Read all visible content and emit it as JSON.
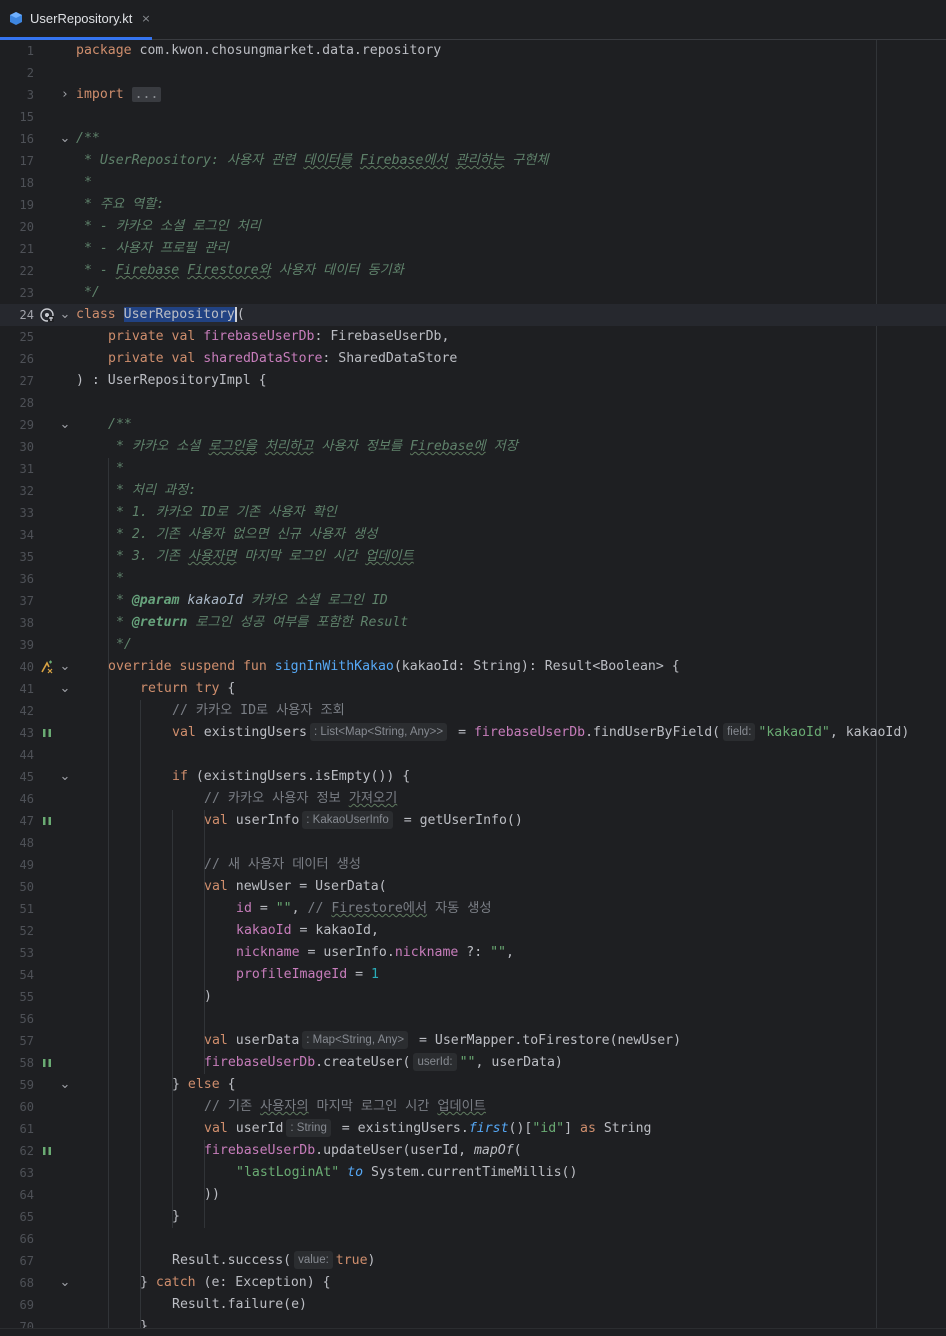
{
  "tab": {
    "title": "UserRepository.kt",
    "close": "×"
  },
  "placeholder": "...",
  "hints": {
    "existingUsers": ": List<Map<String, Any>>",
    "field": "field:",
    "userInfo": ": KakaoUserInfo",
    "userData": ": Map<String, Any>",
    "userIdArg": "userId:",
    "userIdType": ": String",
    "value": "value:"
  },
  "line_numbers": [
    "1",
    "2",
    "3",
    "15",
    "16",
    "17",
    "18",
    "19",
    "20",
    "21",
    "22",
    "23",
    "24",
    "25",
    "26",
    "27",
    "28",
    "29",
    "30",
    "31",
    "32",
    "33",
    "34",
    "35",
    "36",
    "37",
    "38",
    "39",
    "40",
    "41",
    "42",
    "43",
    "44",
    "45",
    "46",
    "47",
    "48",
    "49",
    "50",
    "51",
    "52",
    "53",
    "54",
    "55",
    "56",
    "57",
    "58",
    "59",
    "60",
    "61",
    "62",
    "63",
    "64",
    "65",
    "66",
    "67",
    "68",
    "69",
    "70"
  ],
  "code": {
    "l1": [
      "package",
      " com.kwon.chosungmarket.data.repository"
    ],
    "l3": [
      "import",
      " "
    ],
    "l16": [
      "/**"
    ],
    "l17": [
      " * UserRepository: 사용자 관련 ",
      "데이터를",
      " ",
      "Firebase에서",
      " ",
      "관리하는",
      " 구현체"
    ],
    "l18": [
      " *"
    ],
    "l19": [
      " * 주요 역할:"
    ],
    "l20": [
      " * - 카카오 소셜 로그인 처리"
    ],
    "l21": [
      " * - 사용자 프로필 관리"
    ],
    "l22": [
      " * - ",
      "Firebase",
      " ",
      "Firestore와",
      " 사용자 데이터 동기화"
    ],
    "l23": [
      " */"
    ],
    "l24": [
      "class",
      " ",
      "UserRepository",
      "("
    ],
    "l25": [
      "private val",
      " ",
      "firebaseUserDb",
      ": FirebaseUserDb,"
    ],
    "l26": [
      "private val",
      " ",
      "sharedDataStore",
      ": SharedDataStore"
    ],
    "l27": [
      ") : UserRepositoryImpl {"
    ],
    "l29": [
      "/**"
    ],
    "l30": [
      " * 카카오 소셜 ",
      "로그인을",
      " ",
      "처리하고",
      " 사용자 정보를 ",
      "Firebase에",
      " 저장"
    ],
    "l31": [
      " *"
    ],
    "l32": [
      " * 처리 과정:"
    ],
    "l33": [
      " * 1. 카카오 ID로 기존 사용자 확인"
    ],
    "l34": [
      " * 2. 기존 사용자 없으면 신규 사용자 생성"
    ],
    "l35": [
      " * 3. 기존 ",
      "사용자면",
      " 마지막 로그인 시간 ",
      "업데이트"
    ],
    "l36": [
      " *"
    ],
    "l37": [
      " * ",
      "@param",
      " ",
      "kakaoId",
      " 카카오 소셜 로그인 ID"
    ],
    "l38": [
      " * ",
      "@return",
      " 로그인 성공 여부를 포함한 Result"
    ],
    "l39": [
      " */"
    ],
    "l40": [
      "override suspend fun",
      " ",
      "signInWithKakao",
      "(kakaoId: String): Result<Boolean> {"
    ],
    "l41": [
      "return try",
      " {"
    ],
    "l42": [
      "// 카카오 ID로 사용자 조회"
    ],
    "l43a": [
      "val",
      " existingUsers"
    ],
    "l43b": [
      " = ",
      "firebaseUserDb",
      ".findUserByField(",
      "\"kakaoId\"",
      ", kakaoId)"
    ],
    "l45": [
      "if",
      " (existingUsers.isEmpty()) {"
    ],
    "l46": [
      "// 카카오 사용자 정보 ",
      "가져오기"
    ],
    "l47a": [
      "val",
      " userInfo"
    ],
    "l47b": [
      " = getUserInfo()"
    ],
    "l49": [
      "// 새 사용자 데이터 생성"
    ],
    "l50": [
      "val",
      " newUser = UserData("
    ],
    "l51": [
      "id",
      " = ",
      "\"\"",
      ", ",
      "// ",
      "Firestore에서",
      " 자동 생성"
    ],
    "l52": [
      "kakaoId",
      " = kakaoId,"
    ],
    "l53": [
      "nickname",
      " = userInfo.",
      "nickname",
      " ?: ",
      "\"\"",
      ","
    ],
    "l54": [
      "profileImageId",
      " = ",
      "1"
    ],
    "l55": [
      ")"
    ],
    "l57a": [
      "val",
      " userData"
    ],
    "l57b": [
      " = UserMapper.toFirestore(newUser)"
    ],
    "l58": [
      "firebaseUserDb",
      ".createUser(",
      "\"\"",
      ", userData)"
    ],
    "l59": [
      "} ",
      "else",
      " {"
    ],
    "l60": [
      "// 기존 ",
      "사용자의",
      " 마지막 로그인 시간 ",
      "업데이트"
    ],
    "l61a": [
      "val",
      " userId"
    ],
    "l61b": [
      " = existingUsers.",
      "first",
      "()[",
      "\"id\"",
      "] ",
      "as",
      " String"
    ],
    "l62": [
      "firebaseUserDb",
      ".updateUser(userId, ",
      "mapOf",
      "("
    ],
    "l63": [
      "\"lastLoginAt\"",
      " ",
      "to",
      " System.currentTimeMillis()"
    ],
    "l64": [
      "))"
    ],
    "l65": [
      "}"
    ],
    "l67": [
      "Result.success(",
      "true",
      ")"
    ],
    "l68": [
      "} ",
      "catch",
      " (e: Exception) {"
    ],
    "l69": [
      "Result.failure(e)"
    ],
    "l70": [
      "}"
    ]
  },
  "colors": {
    "background": "#1e1f22",
    "keyword": "#cf8e6d",
    "string": "#6aab73",
    "function": "#56a8f5",
    "property": "#c77dbb",
    "comment": "#7a7e85",
    "doc_comment": "#5f826b",
    "number": "#2aacb8",
    "selection": "#214283",
    "tab_accent": "#3574f0"
  },
  "gutter_icons": {
    "line24": "class-hierarchy-icon",
    "line40": "override-suspend-function-icon",
    "suspend_call": "suspend-call-icon"
  }
}
